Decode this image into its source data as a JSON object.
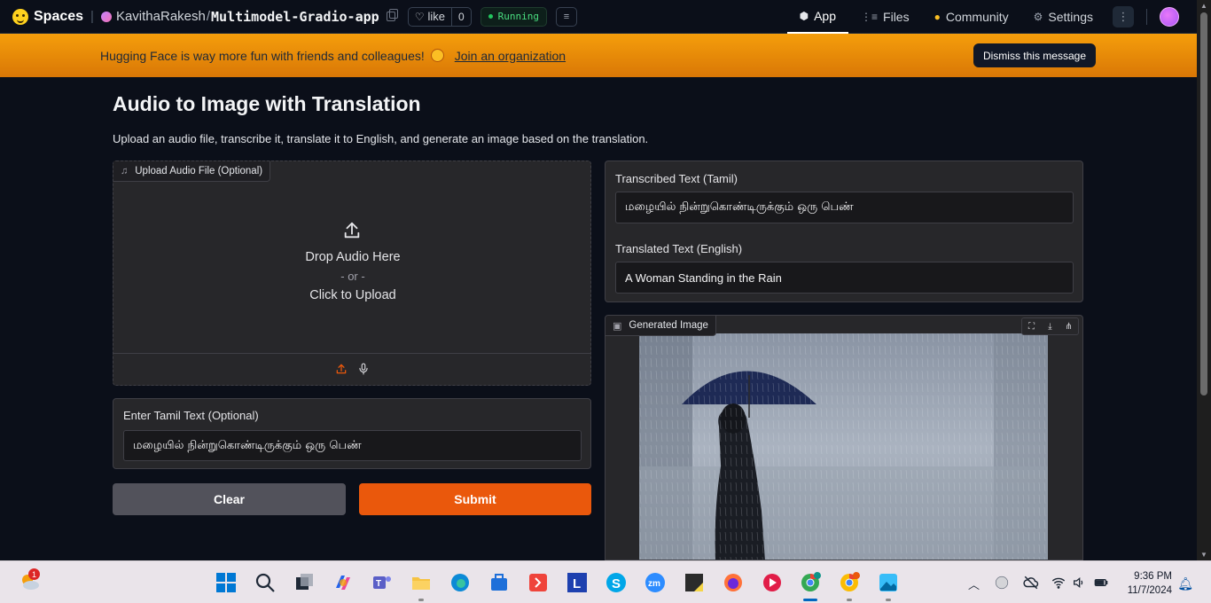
{
  "nav": {
    "brand": "Spaces",
    "owner": "KavithaRakesh",
    "repo": "Multimodel-Gradio-app",
    "like_label": "like",
    "like_count": "0",
    "status": "Running",
    "links": [
      {
        "label": "App",
        "icon": "cube-icon",
        "active": true
      },
      {
        "label": "Files",
        "icon": "files-icon",
        "active": false
      },
      {
        "label": "Community",
        "icon": "community-icon",
        "active": false
      },
      {
        "label": "Settings",
        "icon": "gear-icon",
        "active": false
      }
    ]
  },
  "banner": {
    "text": "Hugging Face is way more fun with friends and colleagues!",
    "link": "Join an organization",
    "dismiss": "Dismiss this message"
  },
  "app": {
    "title": "Audio to Image with Translation",
    "subtitle": "Upload an audio file, transcribe it, translate it to English, and generate an image based on the translation.",
    "audio": {
      "label": "Upload Audio File (Optional)",
      "drop": "Drop Audio Here",
      "or": "- or -",
      "click": "Click to Upload"
    },
    "tamil_input": {
      "label": "Enter Tamil Text (Optional)",
      "value": "மழையில் நின்றுகொண்டிருக்கும் ஒரு பெண்"
    },
    "buttons": {
      "clear": "Clear",
      "submit": "Submit"
    },
    "transcribed": {
      "label": "Transcribed Text (Tamil)",
      "value": "மழையில் நின்றுகொண்டிருக்கும் ஒரு பெண்"
    },
    "translated": {
      "label": "Translated Text (English)",
      "value": "A Woman Standing in the Rain"
    },
    "image": {
      "label": "Generated Image"
    }
  },
  "taskbar": {
    "notification_count": "1",
    "time": "9:36 PM",
    "date": "11/7/2024"
  },
  "colors": {
    "accent": "#ea580c",
    "banner": "#f59e0b",
    "running": "#22c55e"
  }
}
